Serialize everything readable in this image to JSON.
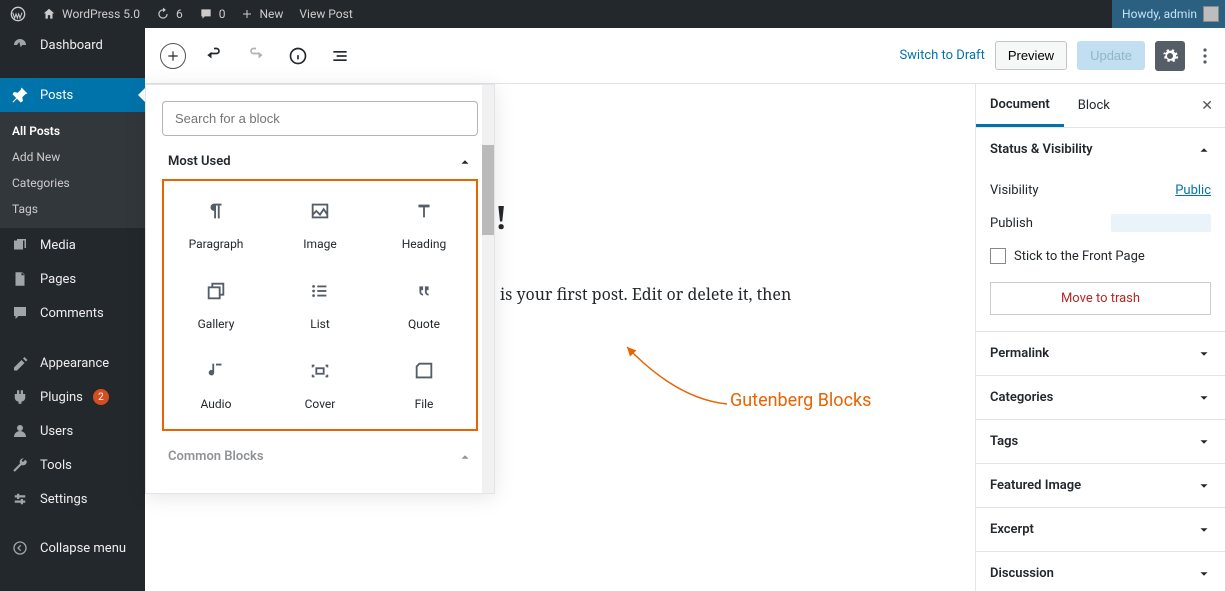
{
  "adminbar": {
    "site": "WordPress 5.0",
    "updates": "6",
    "comments": "0",
    "new": "New",
    "viewpost": "View Post",
    "howdy": "Howdy, admin"
  },
  "sidebar": {
    "items": [
      {
        "label": "Dashboard",
        "icon": "dashboard"
      },
      {
        "label": "Posts",
        "icon": "pin",
        "current": true
      },
      {
        "label": "Media",
        "icon": "media"
      },
      {
        "label": "Pages",
        "icon": "pages"
      },
      {
        "label": "Comments",
        "icon": "comments"
      },
      {
        "label": "Appearance",
        "icon": "appearance"
      },
      {
        "label": "Plugins",
        "icon": "plugins",
        "badge": "2"
      },
      {
        "label": "Users",
        "icon": "users"
      },
      {
        "label": "Tools",
        "icon": "tools"
      },
      {
        "label": "Settings",
        "icon": "settings"
      }
    ],
    "submenu": [
      "All Posts",
      "Add New",
      "Categories",
      "Tags"
    ],
    "collapse": "Collapse menu"
  },
  "editor": {
    "switch_draft": "Switch to Draft",
    "preview": "Preview",
    "update": "Update",
    "post_body": " is your first post. Edit or delete it, then",
    "title_tail": "!"
  },
  "inserter": {
    "search_placeholder": "Search for a block",
    "section1": "Most Used",
    "section2": "Common Blocks",
    "blocks": [
      {
        "label": "Paragraph",
        "icon": "paragraph"
      },
      {
        "label": "Image",
        "icon": "image"
      },
      {
        "label": "Heading",
        "icon": "heading"
      },
      {
        "label": "Gallery",
        "icon": "gallery"
      },
      {
        "label": "List",
        "icon": "list"
      },
      {
        "label": "Quote",
        "icon": "quote"
      },
      {
        "label": "Audio",
        "icon": "audio"
      },
      {
        "label": "Cover",
        "icon": "cover"
      },
      {
        "label": "File",
        "icon": "file"
      }
    ]
  },
  "annotation": {
    "label": "Gutenberg Blocks"
  },
  "settings": {
    "tabs": {
      "document": "Document",
      "block": "Block"
    },
    "status_vis": "Status & Visibility",
    "visibility_label": "Visibility",
    "visibility_value": "Public",
    "publish_label": "Publish",
    "stick": "Stick to the Front Page",
    "trash": "Move to trash",
    "panels": [
      "Permalink",
      "Categories",
      "Tags",
      "Featured Image",
      "Excerpt",
      "Discussion"
    ]
  }
}
